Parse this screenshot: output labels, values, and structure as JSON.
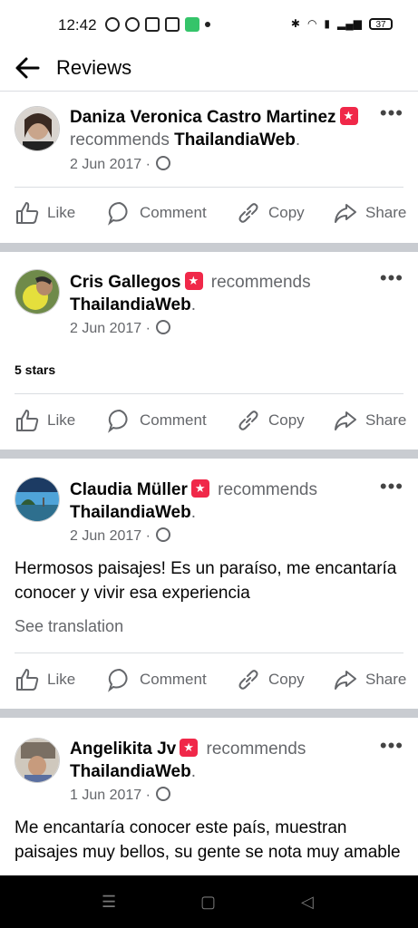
{
  "status_bar": {
    "time": "12:42",
    "battery": "37"
  },
  "header": {
    "title": "Reviews"
  },
  "labels": {
    "recommends": "recommends"
  },
  "actions": {
    "like": "Like",
    "comment": "Comment",
    "copy": "Copy",
    "share": "Share"
  },
  "posts": [
    {
      "name": "Daniza Veronica Castro Martinez",
      "page": "ThailandiaWeb",
      "date": "2 Jun 2017"
    },
    {
      "name": "Cris Gallegos",
      "page": "ThailandiaWeb",
      "date": "2 Jun 2017",
      "rating": "5 stars"
    },
    {
      "name": "Claudia Müller",
      "page": "ThailandiaWeb",
      "date": "2 Jun 2017",
      "text": "Hermosos paisajes! Es un paraíso, me encantaría conocer y vivir esa experiencia",
      "see_translation": "See translation"
    },
    {
      "name": "Angelikita Jv",
      "page": "ThailandiaWeb",
      "date": "1 Jun 2017",
      "text": "Me encantaría conocer este país, muestran paisajes muy bellos, su gente se nota muy amable"
    }
  ]
}
